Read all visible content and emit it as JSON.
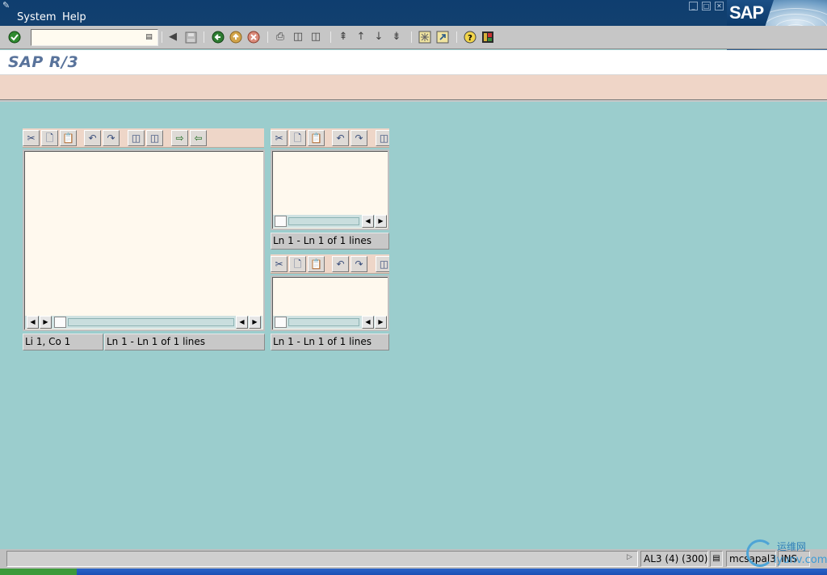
{
  "menubar": {
    "items": [
      {
        "label": "System",
        "accel": "S"
      },
      {
        "label": "Help",
        "accel": "H"
      }
    ],
    "logo": "SAP",
    "window_buttons": [
      "minimize-icon",
      "restore-icon",
      "close-icon"
    ]
  },
  "toolbar": {
    "command_field": {
      "value": "",
      "placeholder": ""
    },
    "icons": [
      "enter-icon",
      "command-dropdown-icon",
      "back-arrow-icon",
      "save-icon",
      "back-icon",
      "exit-icon",
      "cancel-icon",
      "print-icon",
      "find-icon",
      "find-next-icon",
      "first-page-icon",
      "previous-page-icon",
      "next-page-icon",
      "last-page-icon",
      "create-session-icon",
      "generate-shortcut-icon",
      "help-icon",
      "customize-layout-icon"
    ]
  },
  "title": {
    "text": "SAP R/3"
  },
  "editors": {
    "main": {
      "status_position": "Li 1, Co 1",
      "status_lines": "Ln 1 - Ln 1 of 1 lines",
      "toolbar_icons": [
        "cut-icon",
        "copy-icon",
        "paste-icon",
        "undo-icon",
        "redo-icon",
        "find-icon",
        "find-next-icon",
        "load-file-icon",
        "save-file-icon"
      ]
    },
    "top_right": {
      "status_lines": "Ln 1 - Ln 1 of 1 lines",
      "toolbar_icons": [
        "cut-icon",
        "copy-icon",
        "paste-icon",
        "undo-icon",
        "redo-icon",
        "find-icon"
      ]
    },
    "bottom_right": {
      "status_lines": "Ln 1 - Ln 1 of 1 lines",
      "toolbar_icons": [
        "cut-icon",
        "copy-icon",
        "paste-icon",
        "undo-icon",
        "redo-icon",
        "find-icon"
      ]
    }
  },
  "statusbar": {
    "message": "",
    "system": "AL3 (4) (300)",
    "server": "mcsapal3",
    "mode": "INS"
  },
  "watermark": {
    "cn": "运维网",
    "en": "iyunv.com"
  },
  "colors": {
    "background": "#9bcdcd",
    "menubar": "#12406f",
    "toolbar": "#c6c6c6",
    "app_toolbar": "#efd5c7",
    "editor_bg": "#fff9ee",
    "title_text": "#59739b"
  }
}
